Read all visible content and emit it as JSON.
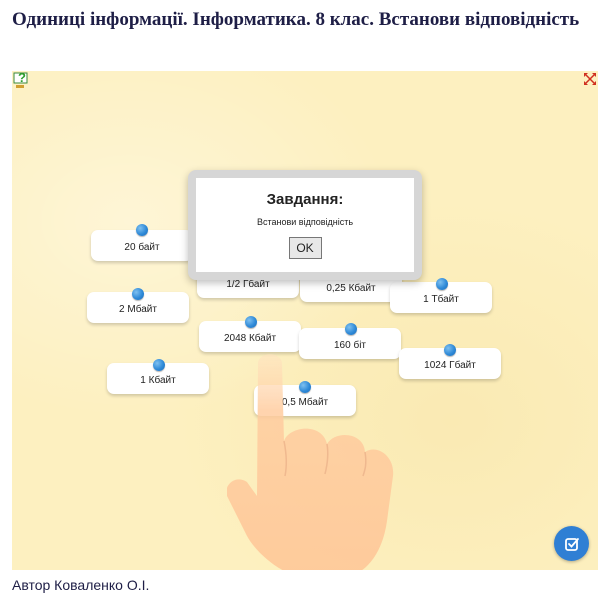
{
  "title": "Одиниці інформації. Інформатика. 8 клас. Встанови відповідність",
  "author": "Автор Коваленко О.І.",
  "toolbar": {
    "help_icon": "help-question-icon",
    "fullscreen_icon": "fullscreen-icon"
  },
  "cards": [
    {
      "label": "20 байт"
    },
    {
      "label": "2 Мбайт"
    },
    {
      "label": "1 Кбайт"
    },
    {
      "label": "2048 Кбайт"
    },
    {
      "label": "160 біт"
    },
    {
      "label": "1 Тбайт"
    },
    {
      "label": "1024 Гбайт"
    },
    {
      "label": "0,5 Мбайт"
    },
    {
      "label": "1/2 Гбайт"
    },
    {
      "label": "0,25 Кбайт"
    }
  ],
  "dialog": {
    "title": "Завдання:",
    "text": "Встанови відповідність",
    "ok_label": "OK"
  },
  "check_button": {
    "icon": "check-icon"
  },
  "colors": {
    "stage_bg": "#fdf0c0",
    "pin": "#2f8ad8",
    "check_button": "#2f7fd4"
  }
}
